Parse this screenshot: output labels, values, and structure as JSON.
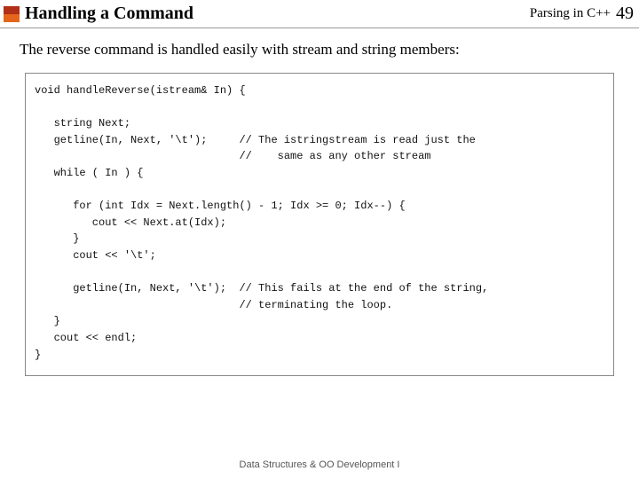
{
  "header": {
    "title": "Handling a Command",
    "context": "Parsing in C++",
    "page_number": "49"
  },
  "intro": "The reverse command is handled easily with stream and string members:",
  "code": "void handleReverse(istream& In) {\n\n   string Next;\n   getline(In, Next, '\\t');     // The istringstream is read just the\n                                //    same as any other stream\n   while ( In ) {\n\n      for (int Idx = Next.length() - 1; Idx >= 0; Idx--) {\n         cout << Next.at(Idx);\n      }\n      cout << '\\t';\n\n      getline(In, Next, '\\t');  // This fails at the end of the string,\n                                // terminating the loop.\n   }\n   cout << endl;\n}",
  "footer": "Data Structures & OO Development I",
  "colors": {
    "logo_top": "#B03018",
    "logo_bottom": "#E5651A"
  }
}
